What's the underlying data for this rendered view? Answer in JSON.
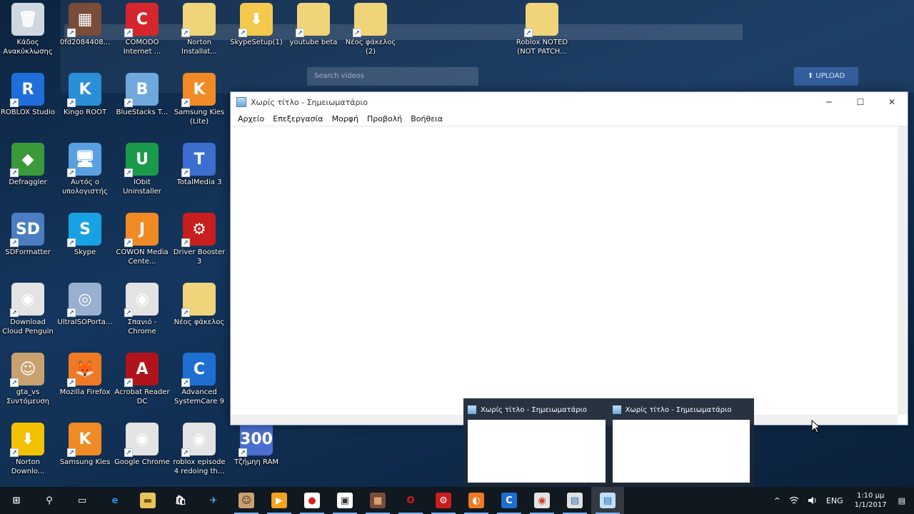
{
  "desktop_icons": [
    {
      "label": "Κάδος Ανακύκλωσης",
      "icon": "recycle-bin-icon",
      "color": "#cfd8e0",
      "glyph": "🗑"
    },
    {
      "label": "0fd2084408...",
      "icon": "image-file-icon",
      "color": "#7a4c3a",
      "glyph": "▦"
    },
    {
      "label": "COMODO Internet ...",
      "icon": "comodo-icon",
      "color": "#d6262d",
      "glyph": "C"
    },
    {
      "label": "Norton Installat...",
      "icon": "folder-icon",
      "color": "#f0d47a",
      "glyph": ""
    },
    {
      "label": "SkypeSetup(1)",
      "icon": "installer-icon",
      "color": "#f2c94c",
      "glyph": "⬇"
    },
    {
      "label": "youtube beta",
      "icon": "folder-icon",
      "color": "#f0d47a",
      "glyph": ""
    },
    {
      "label": "Νέος φάκελος (2)",
      "icon": "folder-icon",
      "color": "#f0d47a",
      "glyph": ""
    },
    {
      "label": "Roblox NOTED (NOT PATCH...",
      "icon": "folder-icon",
      "color": "#f0d47a",
      "glyph": ""
    },
    {
      "label": "ROBLOX Studio",
      "icon": "roblox-studio-icon",
      "color": "#1e6fd9",
      "glyph": "R"
    },
    {
      "label": "Kingo ROOT",
      "icon": "kingo-root-icon",
      "color": "#2a8fd6",
      "glyph": "K"
    },
    {
      "label": "BlueStacks T...",
      "icon": "bluestacks-icon",
      "color": "#6fa8dc",
      "glyph": "B"
    },
    {
      "label": "Samsung Kies (Lite)",
      "icon": "samsung-kies-icon",
      "color": "#f08a24",
      "glyph": "K"
    },
    {
      "label": "Defraggler",
      "icon": "defraggler-icon",
      "color": "#3a9a3a",
      "glyph": "◆"
    },
    {
      "label": "Αυτός ο υπολογιστής",
      "icon": "computer-icon",
      "color": "#5aa0e0",
      "glyph": "🖥"
    },
    {
      "label": "IObit Uninstaller",
      "icon": "iobit-uninstaller-icon",
      "color": "#1a9a4a",
      "glyph": "U"
    },
    {
      "label": "TotalMedia 3",
      "icon": "totalmedia-icon",
      "color": "#3c6ecf",
      "glyph": "T"
    },
    {
      "label": "SDFormatter",
      "icon": "sdformatter-icon",
      "color": "#4a7ec0",
      "glyph": "SD"
    },
    {
      "label": "Skype",
      "icon": "skype-icon",
      "color": "#19a2e3",
      "glyph": "S"
    },
    {
      "label": "COWON Media Cente...",
      "icon": "cowon-icon",
      "color": "#f08a24",
      "glyph": "J"
    },
    {
      "label": "Driver Booster 3",
      "icon": "driver-booster-icon",
      "color": "#c81e1e",
      "glyph": "⚙"
    },
    {
      "label": "Download Cloud Penguin",
      "icon": "chrome-icon",
      "color": "#e3e3e3",
      "glyph": "◉"
    },
    {
      "label": "UltraISOPorta...",
      "icon": "ultraiso-icon",
      "color": "#9ab0d0",
      "glyph": "◎"
    },
    {
      "label": "Σπανιό - Chrome",
      "icon": "chrome-icon",
      "color": "#e3e3e3",
      "glyph": "◉"
    },
    {
      "label": "Νέος φάκελος",
      "icon": "folder-icon",
      "color": "#f0d47a",
      "glyph": ""
    },
    {
      "label": "gta_vs Συντόμευση",
      "icon": "gta-icon",
      "color": "#c9a070",
      "glyph": "☺"
    },
    {
      "label": "Mozilla Firefox",
      "icon": "firefox-icon",
      "color": "#f07a24",
      "glyph": "🦊"
    },
    {
      "label": "Acrobat Reader DC",
      "icon": "acrobat-icon",
      "color": "#b0141a",
      "glyph": "A"
    },
    {
      "label": "Advanced SystemCare 9",
      "icon": "systemcare-icon",
      "color": "#1f6fd1",
      "glyph": "C"
    },
    {
      "label": "Norton Downlo...",
      "icon": "norton-download-icon",
      "color": "#f2c200",
      "glyph": "⬇"
    },
    {
      "label": "Samsung Kies",
      "icon": "samsung-kies-icon",
      "color": "#f08a24",
      "glyph": "K"
    },
    {
      "label": "Google Chrome",
      "icon": "chrome-icon",
      "color": "#e3e3e3",
      "glyph": "◉"
    },
    {
      "label": "roblox episode 4 redoing th...",
      "icon": "chrome-icon",
      "color": "#e3e3e3",
      "glyph": "◉"
    },
    {
      "label": "Τζήμηη RAM",
      "icon": "ram-icon",
      "color": "#4a6fd0",
      "glyph": "300"
    }
  ],
  "background_window": {
    "upload_label": "⬆ UPLOAD",
    "search_placeholder": "Search videos"
  },
  "notepad": {
    "title": "Χωρίς τίτλο - Σημειωματάριο",
    "menu": [
      "Αρχείο",
      "Επεξεργασία",
      "Μορφή",
      "Προβολή",
      "Βοήθεια"
    ],
    "minimize": "─",
    "maximize": "☐",
    "close": "✕"
  },
  "thumbnails": [
    {
      "title": "Χωρίς τίτλο - Σημειωματάριο"
    },
    {
      "title": "Χωρίς τίτλο - Σημειωματάριο"
    }
  ],
  "taskbar": {
    "items": [
      {
        "name": "start-icon",
        "glyph": "⊞",
        "color": "transparent",
        "fg": "#ffffff"
      },
      {
        "name": "search-icon",
        "glyph": "⚲",
        "color": "transparent",
        "fg": "#ffffff"
      },
      {
        "name": "task-view-icon",
        "glyph": "▭",
        "color": "transparent",
        "fg": "#ffffff"
      },
      {
        "name": "edge-icon",
        "glyph": "e",
        "color": "transparent",
        "fg": "#2e8ae6"
      },
      {
        "name": "file-explorer-icon",
        "glyph": "▬",
        "color": "#e8c25a",
        "fg": "#7a5a10"
      },
      {
        "name": "store-icon",
        "glyph": "🛍",
        "color": "transparent",
        "fg": "#ffffff"
      },
      {
        "name": "app-icon",
        "glyph": "✈",
        "color": "transparent",
        "fg": "#5ab0f0"
      },
      {
        "name": "gta-icon",
        "glyph": "☺",
        "color": "#c9a070",
        "fg": "#3a2a1a"
      },
      {
        "name": "media-player-icon",
        "glyph": "▶",
        "color": "#f3a21c",
        "fg": "#ffffff"
      },
      {
        "name": "record-icon",
        "glyph": "●",
        "color": "#ffffff",
        "fg": "#d81e1e"
      },
      {
        "name": "monitor-icon",
        "glyph": "▣",
        "color": "#ffffff",
        "fg": "#333333"
      },
      {
        "name": "game-icon",
        "glyph": "▦",
        "color": "#7a4c3a",
        "fg": "#ffd08a"
      },
      {
        "name": "opera-icon",
        "glyph": "O",
        "color": "transparent",
        "fg": "#e5141c"
      },
      {
        "name": "driver-booster-icon",
        "glyph": "⚙",
        "color": "#c81e1e",
        "fg": "#ffffff"
      },
      {
        "name": "firefox-icon",
        "glyph": "◐",
        "color": "#f07a24",
        "fg": "#ffffff"
      },
      {
        "name": "systemcare-icon",
        "glyph": "C",
        "color": "#1f6fd1",
        "fg": "#ffffff"
      },
      {
        "name": "chrome-icon",
        "glyph": "◉",
        "color": "#e3e3e3",
        "fg": "#d23b2d"
      },
      {
        "name": "notepad-group-icon",
        "glyph": "▤",
        "color": "#e0e0e0",
        "fg": "#2a6ab0"
      },
      {
        "name": "notepad-icon",
        "glyph": "▤",
        "color": "#bfe0f7",
        "fg": "#2a6ab0"
      }
    ],
    "tray": {
      "chevron": "^",
      "language": "ENG",
      "time": "1:10 μμ",
      "date": "1/1/2017",
      "notifications": "▤"
    }
  }
}
